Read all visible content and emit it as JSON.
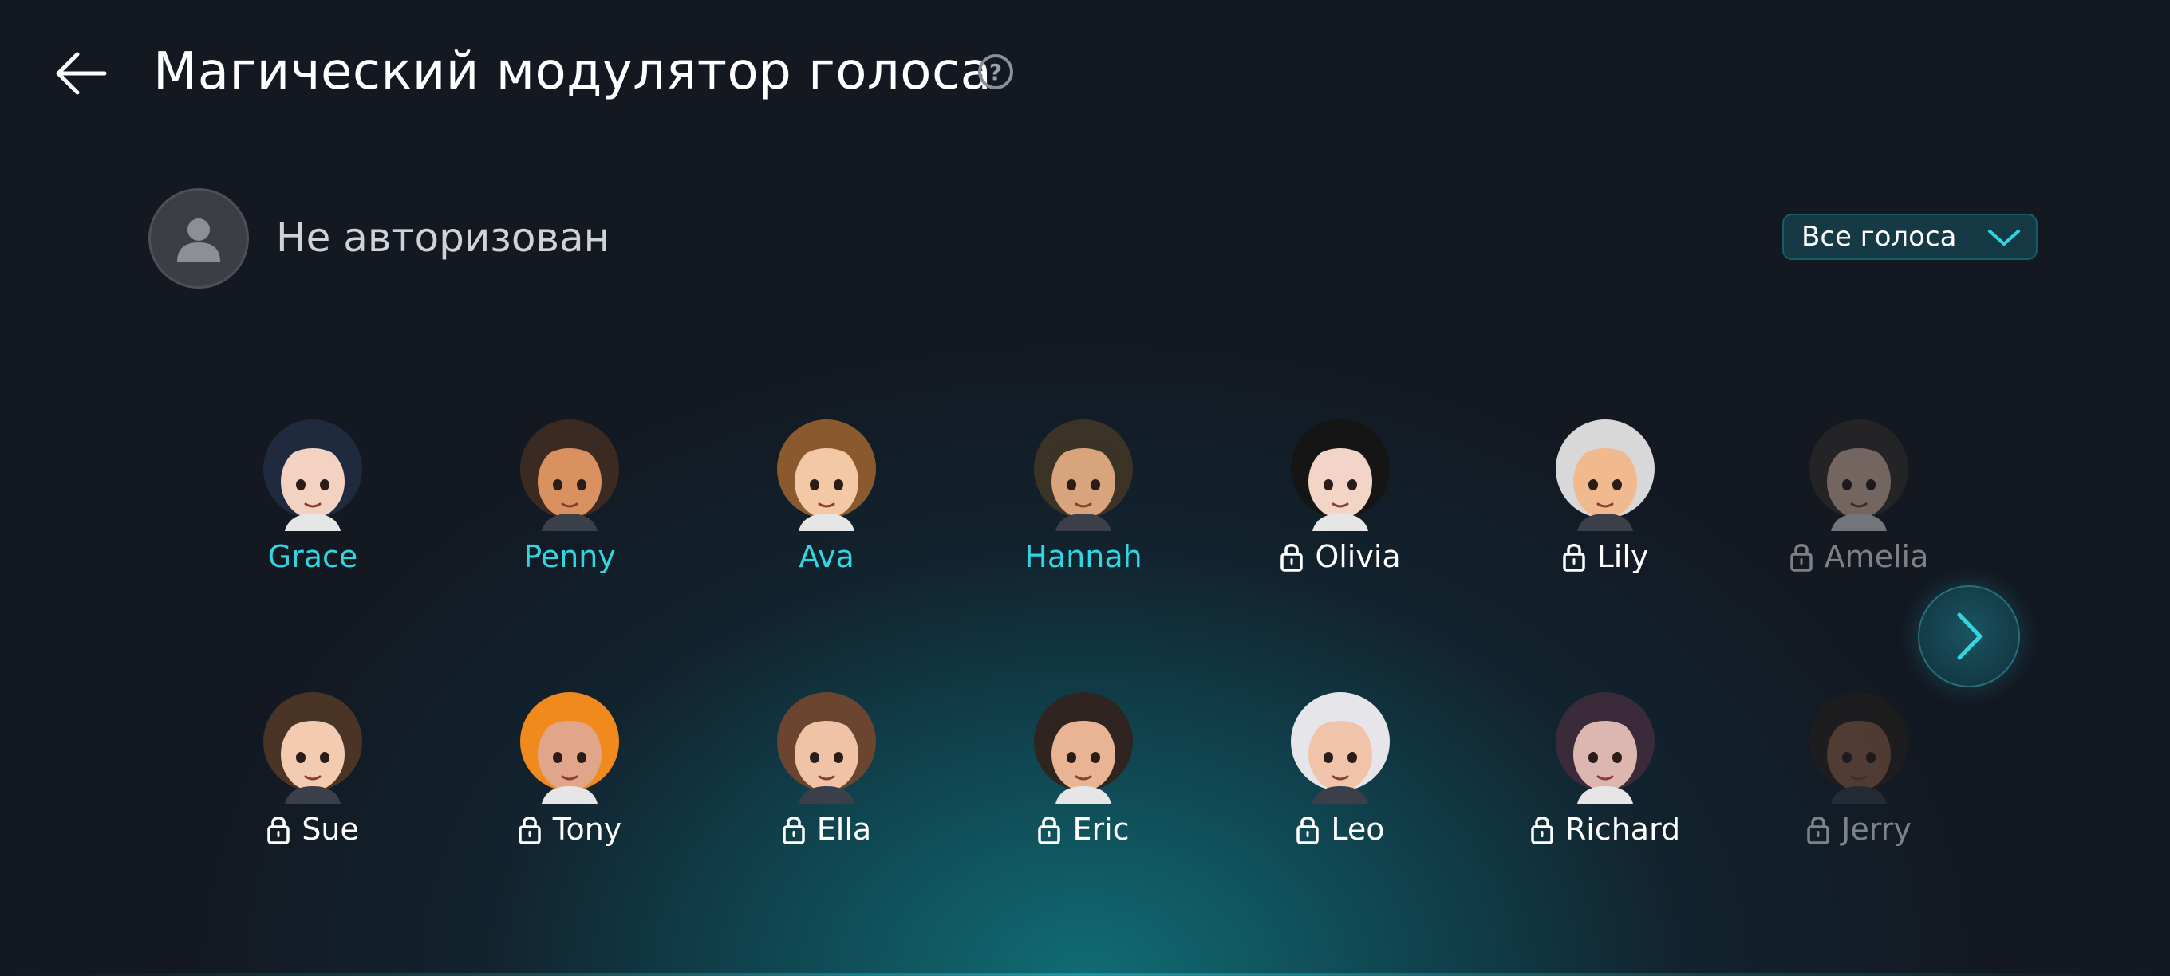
{
  "header": {
    "title": "Магический модулятор голоса",
    "help_icon": "question-circle-icon",
    "back_icon": "arrow-left-icon"
  },
  "user": {
    "status": "Не авторизован",
    "avatar_icon": "person-icon"
  },
  "filter": {
    "selected": "Все голоса",
    "chevron_icon": "chevron-down-icon"
  },
  "colors": {
    "accent": "#31d6e2",
    "background": "#131821",
    "glow": "#0e5a66"
  },
  "voices": {
    "row1": [
      {
        "name": "Grace",
        "locked": false,
        "hair": "#1f2a3f",
        "skin": "#f4d2c2"
      },
      {
        "name": "Penny",
        "locked": false,
        "hair": "#3a2a22",
        "skin": "#d9925f"
      },
      {
        "name": "Ava",
        "locked": false,
        "hair": "#8a5a2e",
        "skin": "#f3c9a5"
      },
      {
        "name": "Hannah",
        "locked": false,
        "hair": "#3b3326",
        "skin": "#d7a47c"
      },
      {
        "name": "Olivia",
        "locked": true,
        "hair": "#151515",
        "skin": "#f2d5c6"
      },
      {
        "name": "Lily",
        "locked": true,
        "hair": "#d8d8d8",
        "skin": "#f0b98e"
      },
      {
        "name": "Amelia",
        "locked": true,
        "hair": "#3a332e",
        "skin": "#e9c5b0"
      }
    ],
    "row2": [
      {
        "name": "Sue",
        "locked": true,
        "hair": "#4a3426",
        "skin": "#f2cbb0"
      },
      {
        "name": "Tony",
        "locked": true,
        "hair": "#f08a1c",
        "skin": "#e1a58a"
      },
      {
        "name": "Ella",
        "locked": true,
        "hair": "#6b4530",
        "skin": "#f0c3a6"
      },
      {
        "name": "Eric",
        "locked": true,
        "hair": "#2f2420",
        "skin": "#e9b493"
      },
      {
        "name": "Leo",
        "locked": true,
        "hair": "#e6e6ea",
        "skin": "#f0c4aa"
      },
      {
        "name": "Richard",
        "locked": true,
        "hair": "#3b2a3a",
        "skin": "#dcb7b0"
      },
      {
        "name": "Jerry",
        "locked": true,
        "hair": "#2b2018",
        "skin": "#9a6445"
      }
    ]
  },
  "pager": {
    "next_icon": "chevron-right-icon"
  }
}
